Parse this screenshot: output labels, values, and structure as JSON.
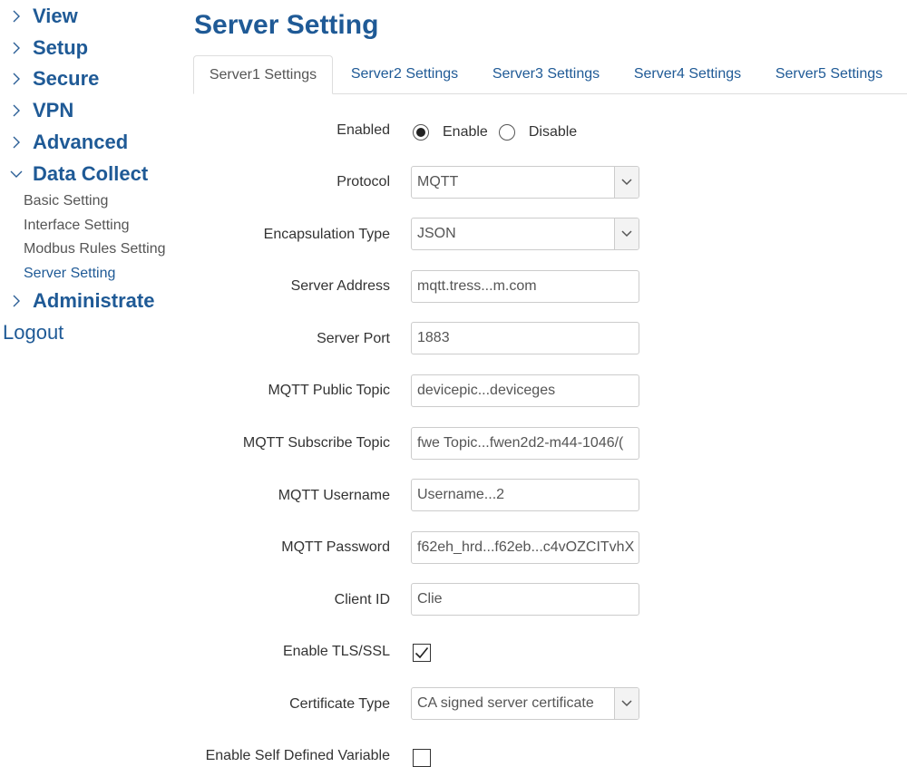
{
  "sidebar": {
    "items": [
      {
        "label": "View"
      },
      {
        "label": "Setup"
      },
      {
        "label": "Secure"
      },
      {
        "label": "VPN"
      },
      {
        "label": "Advanced"
      },
      {
        "label": "Data Collect"
      },
      {
        "label": "Administrate"
      }
    ],
    "sub_items": [
      {
        "label": "Basic Setting"
      },
      {
        "label": "Interface Setting"
      },
      {
        "label": "Modbus Rules Setting"
      },
      {
        "label": "Server Setting"
      }
    ],
    "logout": "Logout"
  },
  "page": {
    "title": "Server Setting"
  },
  "tabs": [
    {
      "label": "Server1 Settings"
    },
    {
      "label": "Server2 Settings"
    },
    {
      "label": "Server3 Settings"
    },
    {
      "label": "Server4 Settings"
    },
    {
      "label": "Server5 Settings"
    }
  ],
  "form": {
    "enabled": {
      "label": "Enabled",
      "option_enable": "Enable",
      "option_disable": "Disable",
      "selected": "Enable"
    },
    "protocol": {
      "label": "Protocol",
      "value": "MQTT"
    },
    "encapsulation": {
      "label": "Encapsulation Type",
      "value": "JSON"
    },
    "server_address": {
      "label": "Server Address",
      "value": "mqtt.tress...m.com"
    },
    "server_port": {
      "label": "Server Port",
      "value": "1883"
    },
    "public_topic": {
      "label": "MQTT Public Topic",
      "value": "devicepic...deviceges"
    },
    "subscribe_topic": {
      "label": "MQTT Subscribe Topic",
      "value": "fwe Topic...fwen2d2-m44-1046/("
    },
    "username": {
      "label": "MQTT Username",
      "value": "Username...2"
    },
    "password": {
      "label": "MQTT Password",
      "value": "f62eh_hrd...f62eb...c4vOZCITvhX"
    },
    "client_id": {
      "label": "Client ID",
      "value": "Clie"
    },
    "tls": {
      "label": "Enable TLS/SSL",
      "checked": true
    },
    "cert_type": {
      "label": "Certificate Type",
      "value": "CA signed server certificate"
    },
    "self_defined": {
      "label": "Enable Self Defined Variable",
      "checked": false
    }
  },
  "colors": {
    "accent": "#1f5a96",
    "text": "#333333",
    "border": "#cccccc"
  },
  "icons": {
    "nav": "chevron-right-icon",
    "nav_open": "chevron-down-icon",
    "select": "chevron-down-icon",
    "check": "checkmark-icon"
  }
}
